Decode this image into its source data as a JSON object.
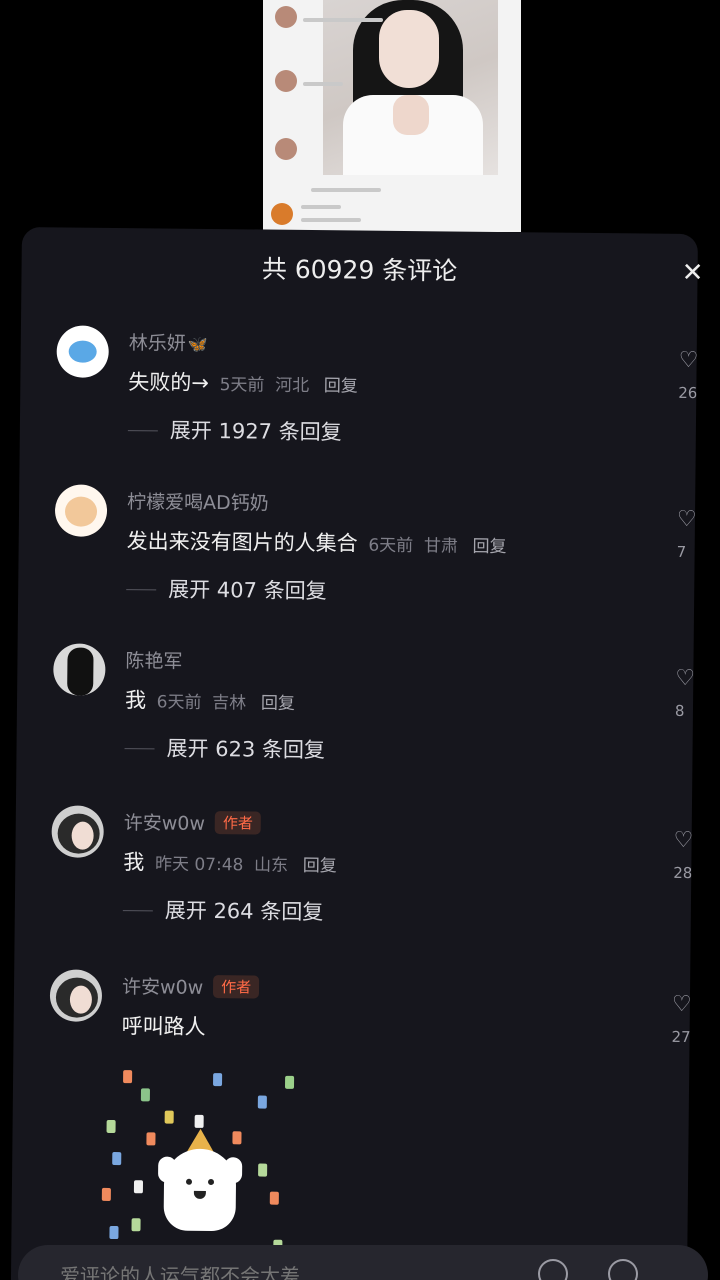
{
  "header": {
    "title": "共 60929 条评论",
    "close_icon": "close-icon"
  },
  "comments": [
    {
      "username": "林乐妍",
      "name_emoji": "🦋",
      "author": false,
      "text": "失败的→",
      "time": "5天前",
      "location": "河北",
      "reply_label": "回复",
      "expand_label": "展开 1927 条回复",
      "like_count": "26"
    },
    {
      "username": "柠檬爱喝AD钙奶",
      "author": false,
      "text": "发出来没有图片的人集合",
      "time": "6天前",
      "location": "甘肃",
      "reply_label": "回复",
      "expand_label": "展开 407 条回复",
      "like_count": "7"
    },
    {
      "username": "陈艳军",
      "author": false,
      "text": "我",
      "time": "6天前",
      "location": "吉林",
      "reply_label": "回复",
      "expand_label": "展开 623 条回复",
      "like_count": "8"
    },
    {
      "username": "许安w0w",
      "author": true,
      "author_badge": "作者",
      "text": "我",
      "time": "昨天 07:48",
      "location": "山东",
      "reply_label": "回复",
      "expand_label": "展开 264 条回复",
      "like_count": "28"
    },
    {
      "username": "许安w0w",
      "author": true,
      "author_badge": "作者",
      "text": "呼叫路人",
      "like_count": "27",
      "sticker": "party-dog-sticker"
    }
  ],
  "input": {
    "placeholder": "爱评论的人运气都不会太差"
  },
  "colors": {
    "panel_bg": "#16161d",
    "author_badge": "#ff6a47",
    "meta_text": "#7e7e88"
  }
}
